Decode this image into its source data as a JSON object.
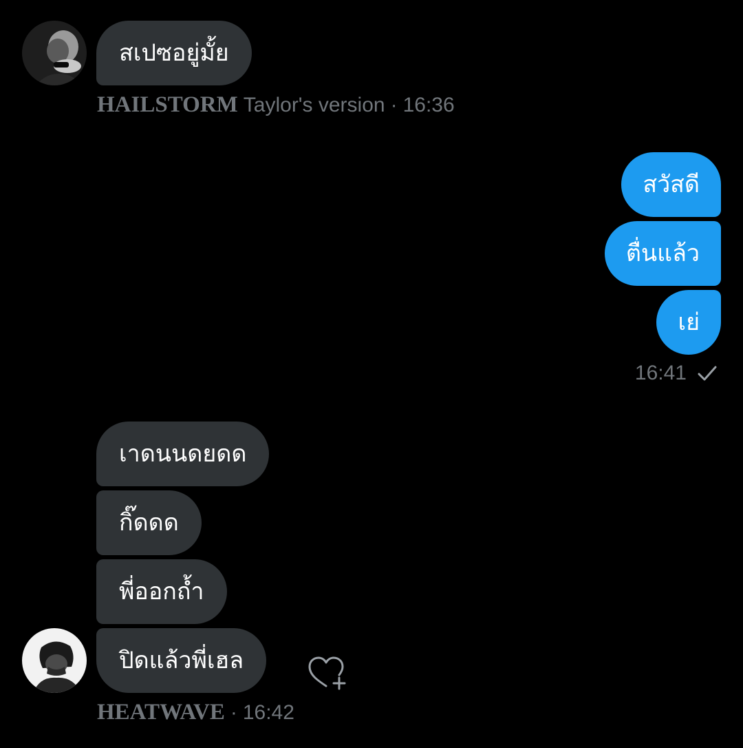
{
  "conversation": {
    "group1": {
      "messages": [
        "สเปซอยู่มั้ย"
      ],
      "sender_name": "HAILSTORM",
      "sender_suffix": "Taylor's version",
      "separator": "·",
      "time": "16:36"
    },
    "group2": {
      "messages": [
        "สวัสดี",
        "ตื่นแล้ว",
        "เย่"
      ],
      "time": "16:41",
      "status_icon": "checkmark-icon"
    },
    "group3": {
      "messages": [
        "เาดนนดยดด",
        "กิ๊ดดด",
        "พี่ออกถ้ำ",
        "ปิดแล้วพี่เฮล"
      ],
      "sender_name": "HEATWAVE",
      "separator": "·",
      "time": "16:42",
      "reaction_icon": "heart-plus-icon"
    }
  },
  "colors": {
    "background": "#000000",
    "incoming_bubble": "#2f3336",
    "outgoing_bubble": "#1d9bf0",
    "meta_text": "#71767b"
  }
}
